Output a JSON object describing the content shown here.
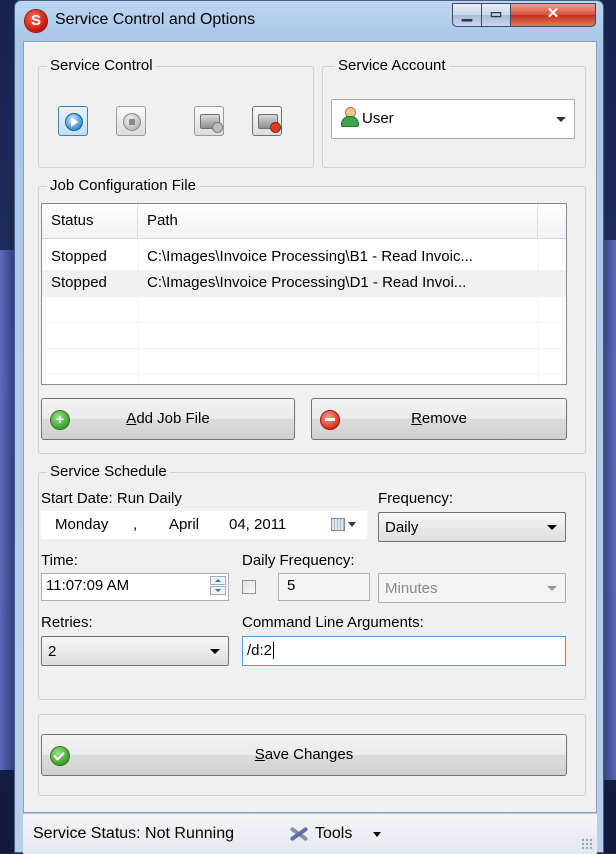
{
  "window": {
    "title": "Service Control and Options"
  },
  "service_control": {
    "label": "Service Control"
  },
  "service_account": {
    "label": "Service Account",
    "selected": "User"
  },
  "job_config": {
    "label": "Job Configuration File",
    "columns": [
      "Status",
      "Path"
    ],
    "rows": [
      {
        "status": "Stopped",
        "path": "C:\\Images\\Invoice Processing\\B1 - Read Invoic..."
      },
      {
        "status": "Stopped",
        "path": "C:\\Images\\Invoice Processing\\D1 - Read Invoi..."
      }
    ],
    "add_button": {
      "mnemonic": "A",
      "rest": "dd Job File"
    },
    "remove_button": {
      "mnemonic": "R",
      "rest": "emove"
    }
  },
  "schedule": {
    "label": "Service Schedule",
    "start_date_label": "Start Date: Run Daily",
    "date": {
      "weekday": "Monday",
      "sep": ",",
      "month": "April",
      "day_year": "04, 2011"
    },
    "frequency_label": "Frequency:",
    "frequency_value": "Daily",
    "time_label": "Time:",
    "time_value": "11:07:09 AM",
    "daily_frequency_label": "Daily Frequency:",
    "daily_frequency_value": "5",
    "daily_frequency_unit": "Minutes",
    "retries_label": "Retries:",
    "retries_value": "2",
    "args_label": "Command Line Arguments:",
    "args_value": "/d:2"
  },
  "save_button": {
    "mnemonic": "S",
    "rest": "ave Changes"
  },
  "statusbar": {
    "status_text": "Service Status: Not Running",
    "tools_label": "Tools"
  },
  "colors": {
    "accent_blue": "#3c7fb1",
    "title_close_red": "#c2301b",
    "add_green": "#3a9a2a",
    "remove_red": "#d62a17"
  },
  "icons": [
    "app-icon",
    "play-icon",
    "stop-icon",
    "install-service-icon",
    "uninstall-service-icon",
    "user-icon",
    "add-icon",
    "remove-icon",
    "check-icon",
    "calendar-icon",
    "tools-icon"
  ]
}
